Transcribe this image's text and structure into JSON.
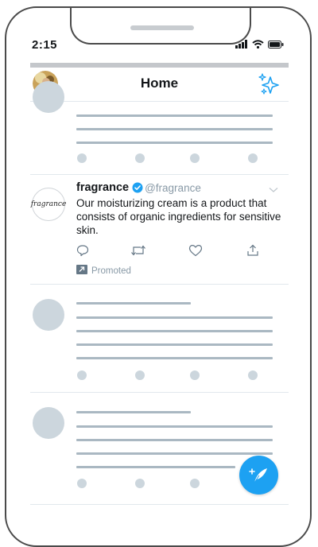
{
  "status_bar": {
    "time": "2:15"
  },
  "header": {
    "title": "Home"
  },
  "tweet": {
    "name": "fragrance",
    "handle": "@fragrance",
    "logo_text": "fragrance",
    "text": "Our moisturizing cream is a product that consists of organic ingredients for sensitive skin.",
    "promoted_label": "Promoted"
  },
  "colors": {
    "accent": "#1da1f2",
    "skeleton_line": "#aab8c2",
    "skeleton_shape": "#ccd6dd",
    "divider": "#e1e8ed",
    "muted_text": "#8899a6"
  },
  "icons": [
    "wifi-icon",
    "battery-icon",
    "signal-icon",
    "sparkle-icon",
    "verified-icon",
    "reply-icon",
    "retweet-icon",
    "like-icon",
    "share-icon",
    "promoted-icon",
    "compose-icon",
    "chevron-down-icon"
  ]
}
